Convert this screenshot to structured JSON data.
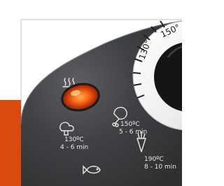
{
  "colors": {
    "background": "#ffffff",
    "frame_border": "#d7d7d7",
    "orange_accent": "#d94a0e",
    "panel_dark": "#343638",
    "panel_light": "#4a4c4f",
    "text_light": "#e9e9e9",
    "indicator_glow": "#ff5a17",
    "dial_face": "#f2f2f2",
    "knob_black": "#111111"
  },
  "dial": {
    "labels": [
      "130°",
      "150°"
    ]
  },
  "settings": [
    {
      "icon": "mushroom-icon",
      "temp": "130ºC",
      "time": "4 - 6 min"
    },
    {
      "icon": "chicken-leg-icon",
      "temp": "150ºC",
      "time": "5 - 6 min"
    },
    {
      "icon": "fries-cone-icon",
      "temp": "190ºC",
      "time": "8 - 10 min"
    },
    {
      "icon": "fish-icon",
      "temp": "",
      "time": ""
    }
  ],
  "indicator": {
    "icon": "steam-icon",
    "state": "lit"
  }
}
